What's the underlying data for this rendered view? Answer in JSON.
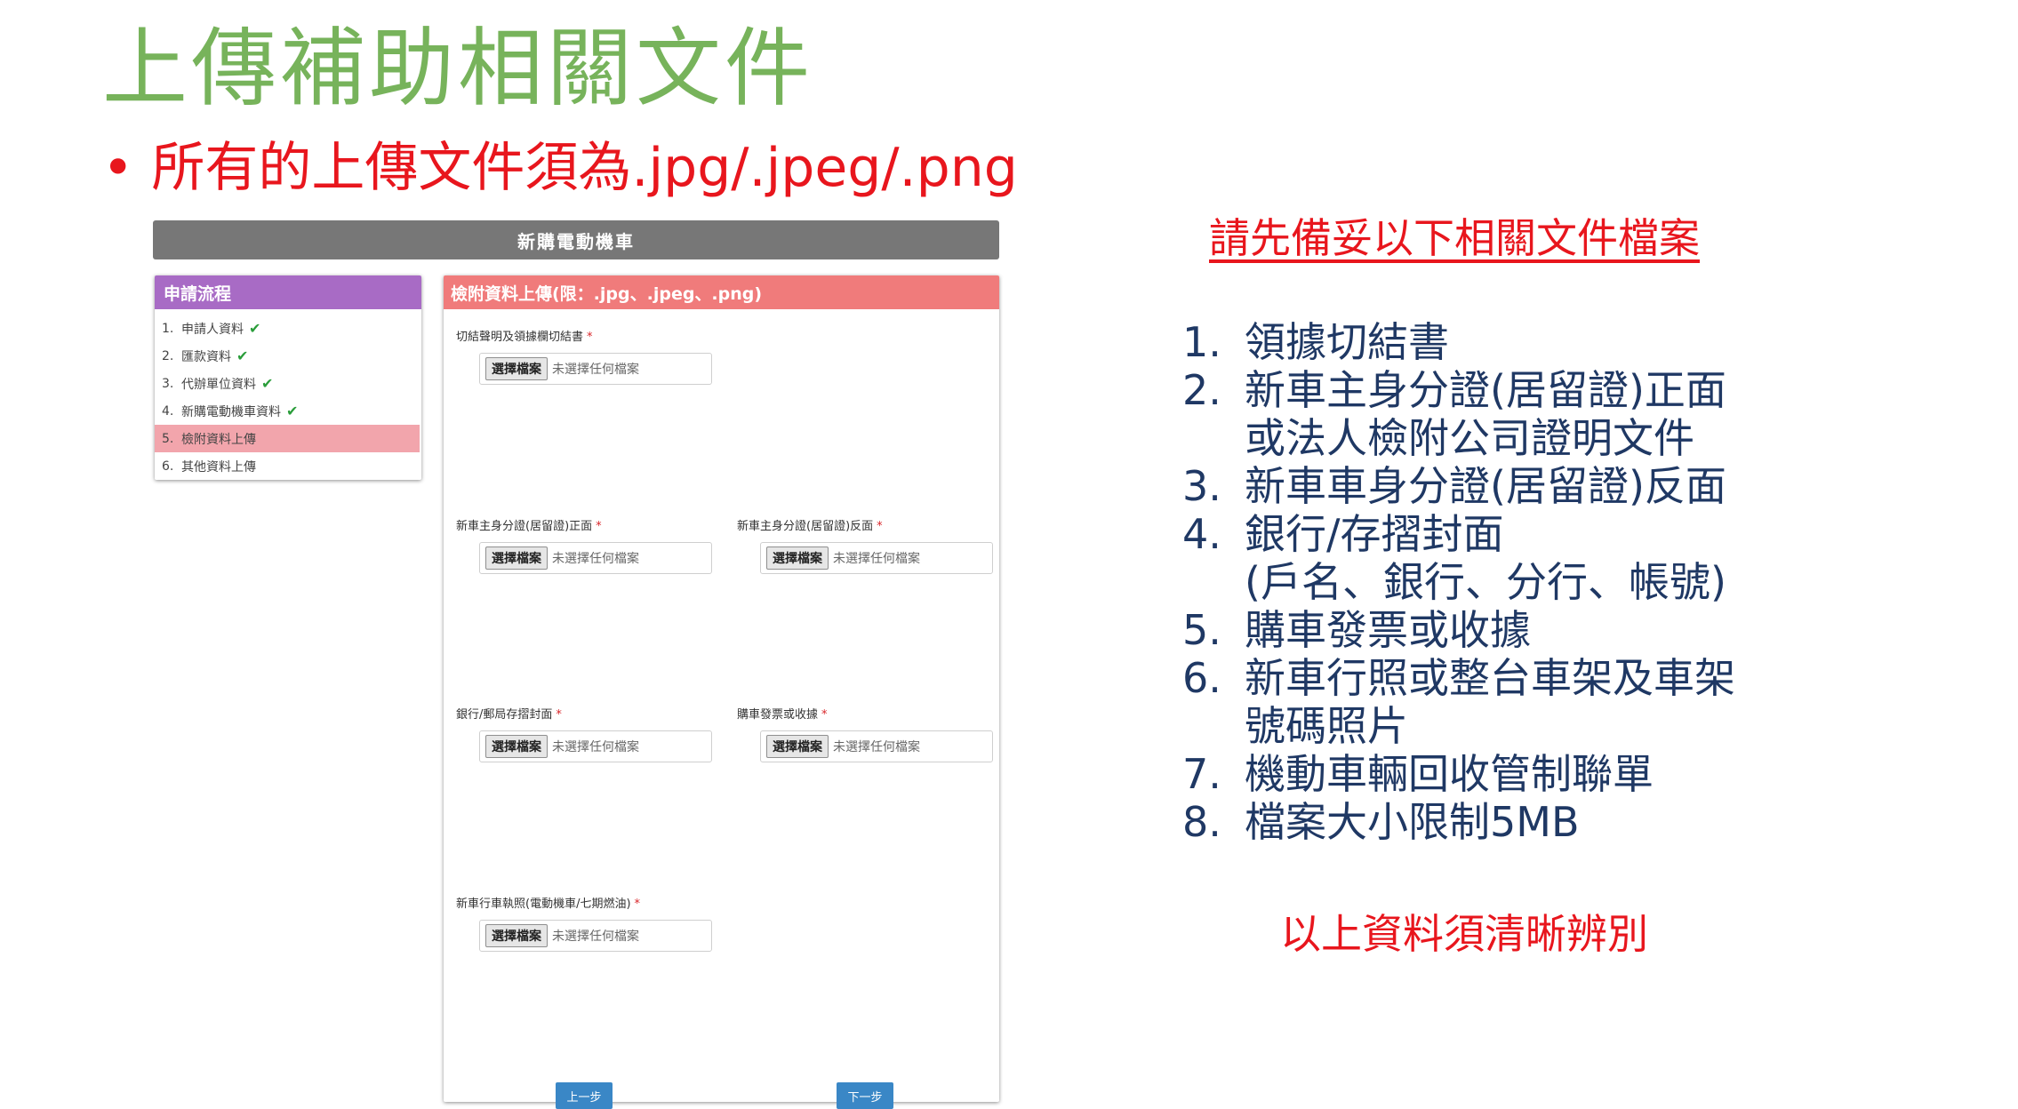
{
  "slide": {
    "title": "上傳補助相關文件",
    "bullet": "所有的上傳文件須為.jpg/.jpeg/.png",
    "bullet_marker": "•"
  },
  "screenshot": {
    "header": "新購電動機車",
    "steps": {
      "title": "申請流程",
      "items": [
        {
          "num": "1.",
          "label": "申請人資料",
          "done": true
        },
        {
          "num": "2.",
          "label": "匯款資料",
          "done": true
        },
        {
          "num": "3.",
          "label": "代辦單位資料",
          "done": true
        },
        {
          "num": "4.",
          "label": "新購電動機車資料",
          "done": true
        },
        {
          "num": "5.",
          "label": "檢附資料上傳",
          "done": false,
          "active": true
        },
        {
          "num": "6.",
          "label": "其他資料上傳",
          "done": false
        }
      ],
      "check_glyph": "✔"
    },
    "form": {
      "title": "檢附資料上傳(限：.jpg、.jpeg、.png)",
      "required_mark": "*",
      "file_button": "選擇檔案",
      "file_status": "未選擇任何檔案",
      "fields": [
        {
          "label": "切結聲明及領據欄切結書"
        },
        {
          "label": "新車主身分證(居留證)正面"
        },
        {
          "label": "新車主身分證(居留證)反面"
        },
        {
          "label": "銀行/郵局存摺封面"
        },
        {
          "label": "購車發票或收據"
        },
        {
          "label": "新車行車執照(電動機車/七期燃油)"
        }
      ],
      "prev_button": "上一步",
      "next_button": "下一步"
    }
  },
  "notes": {
    "heading": "請先備妥以下相關文件檔案",
    "items": [
      {
        "num": "1.",
        "text": "領據切結書"
      },
      {
        "num": "2.",
        "text": "新車主身分證(居留證)正面\n或法人檢附公司證明文件"
      },
      {
        "num": "3.",
        "text": "新車車身分證(居留證)反面"
      },
      {
        "num": "4.",
        "text": "銀行/存摺封面\n(戶名、銀行、分行、帳號)"
      },
      {
        "num": "5.",
        "text": "購車發票或收據"
      },
      {
        "num": "6.",
        "text": "新車行照或整台車架及車架\n號碼照片"
      },
      {
        "num": "7.",
        "text": "機動車輛回收管制聯單"
      },
      {
        "num": "8.",
        "text": "檔案大小限制5MB"
      }
    ],
    "closing": "以上資料須清晰辨別"
  }
}
